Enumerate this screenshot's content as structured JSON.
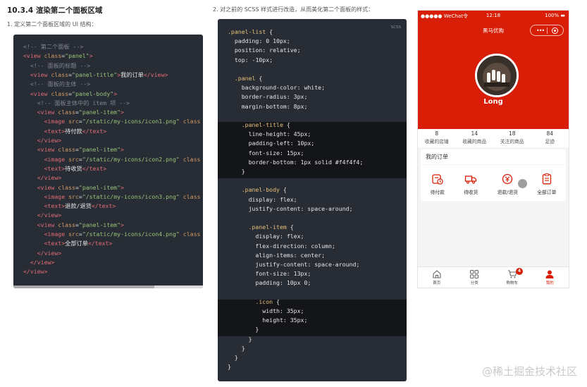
{
  "section_title": "10.3.4 渲染第二个面板区域",
  "step1": "1. 定义第二个面板区域的 UI 结构：",
  "step2": "2. 对之前的 SCSS 样式进行改造，从而美化第二个面板的样式：",
  "xml_code": [
    [
      {
        "c": "c-comment",
        "t": "<!-- 第二个面板 -->"
      }
    ],
    [
      {
        "c": "c-tag",
        "t": "<view "
      },
      {
        "c": "c-attr",
        "t": "class"
      },
      {
        "c": "c-txt",
        "t": "="
      },
      {
        "c": "c-str",
        "t": "\"panel\""
      },
      {
        "c": "c-tag",
        "t": ">"
      }
    ],
    [
      {
        "c": "c-txt",
        "t": "  "
      },
      {
        "c": "c-comment",
        "t": "<!-- 面板的标题 -->"
      }
    ],
    [
      {
        "c": "c-txt",
        "t": "  "
      },
      {
        "c": "c-tag",
        "t": "<view "
      },
      {
        "c": "c-attr",
        "t": "class"
      },
      {
        "c": "c-txt",
        "t": "="
      },
      {
        "c": "c-str",
        "t": "\"panel-title\""
      },
      {
        "c": "c-tag",
        "t": ">"
      },
      {
        "c": "c-txt",
        "t": "我的订单"
      },
      {
        "c": "c-tag",
        "t": "</view>"
      }
    ],
    [
      {
        "c": "c-txt",
        "t": "  "
      },
      {
        "c": "c-comment",
        "t": "<!-- 面板的主体 -->"
      }
    ],
    [
      {
        "c": "c-txt",
        "t": "  "
      },
      {
        "c": "c-tag",
        "t": "<view "
      },
      {
        "c": "c-attr",
        "t": "class"
      },
      {
        "c": "c-txt",
        "t": "="
      },
      {
        "c": "c-str",
        "t": "\"panel-body\""
      },
      {
        "c": "c-tag",
        "t": ">"
      }
    ],
    [
      {
        "c": "c-txt",
        "t": "    "
      },
      {
        "c": "c-comment",
        "t": "<!-- 面板主体中的 item 项 -->"
      }
    ],
    [
      {
        "c": "c-txt",
        "t": "    "
      },
      {
        "c": "c-tag",
        "t": "<view "
      },
      {
        "c": "c-attr",
        "t": "class"
      },
      {
        "c": "c-txt",
        "t": "="
      },
      {
        "c": "c-str",
        "t": "\"panel-item\""
      },
      {
        "c": "c-tag",
        "t": ">"
      }
    ],
    [
      {
        "c": "c-txt",
        "t": "      "
      },
      {
        "c": "c-tag",
        "t": "<image "
      },
      {
        "c": "c-attr",
        "t": "src"
      },
      {
        "c": "c-txt",
        "t": "="
      },
      {
        "c": "c-str",
        "t": "\"/static/my-icons/icon1.png\""
      },
      {
        "c": "c-attr",
        "t": " class"
      }
    ],
    [
      {
        "c": "c-txt",
        "t": "      "
      },
      {
        "c": "c-tag",
        "t": "<text>"
      },
      {
        "c": "c-txt",
        "t": "待付款"
      },
      {
        "c": "c-tag",
        "t": "</text>"
      }
    ],
    [
      {
        "c": "c-txt",
        "t": "    "
      },
      {
        "c": "c-tag",
        "t": "</view>"
      }
    ],
    [
      {
        "c": "c-txt",
        "t": "    "
      },
      {
        "c": "c-tag",
        "t": "<view "
      },
      {
        "c": "c-attr",
        "t": "class"
      },
      {
        "c": "c-txt",
        "t": "="
      },
      {
        "c": "c-str",
        "t": "\"panel-item\""
      },
      {
        "c": "c-tag",
        "t": ">"
      }
    ],
    [
      {
        "c": "c-txt",
        "t": "      "
      },
      {
        "c": "c-tag",
        "t": "<image "
      },
      {
        "c": "c-attr",
        "t": "src"
      },
      {
        "c": "c-txt",
        "t": "="
      },
      {
        "c": "c-str",
        "t": "\"/static/my-icons/icon2.png\""
      },
      {
        "c": "c-attr",
        "t": " class"
      }
    ],
    [
      {
        "c": "c-txt",
        "t": "      "
      },
      {
        "c": "c-tag",
        "t": "<text>"
      },
      {
        "c": "c-txt",
        "t": "待收货"
      },
      {
        "c": "c-tag",
        "t": "</text>"
      }
    ],
    [
      {
        "c": "c-txt",
        "t": "    "
      },
      {
        "c": "c-tag",
        "t": "</view>"
      }
    ],
    [
      {
        "c": "c-txt",
        "t": "    "
      },
      {
        "c": "c-tag",
        "t": "<view "
      },
      {
        "c": "c-attr",
        "t": "class"
      },
      {
        "c": "c-txt",
        "t": "="
      },
      {
        "c": "c-str",
        "t": "\"panel-item\""
      },
      {
        "c": "c-tag",
        "t": ">"
      }
    ],
    [
      {
        "c": "c-txt",
        "t": "      "
      },
      {
        "c": "c-tag",
        "t": "<image "
      },
      {
        "c": "c-attr",
        "t": "src"
      },
      {
        "c": "c-txt",
        "t": "="
      },
      {
        "c": "c-str",
        "t": "\"/static/my-icons/icon3.png\""
      },
      {
        "c": "c-attr",
        "t": " class"
      }
    ],
    [
      {
        "c": "c-txt",
        "t": "      "
      },
      {
        "c": "c-tag",
        "t": "<text>"
      },
      {
        "c": "c-txt",
        "t": "退款/退货"
      },
      {
        "c": "c-tag",
        "t": "</text>"
      }
    ],
    [
      {
        "c": "c-txt",
        "t": "    "
      },
      {
        "c": "c-tag",
        "t": "</view>"
      }
    ],
    [
      {
        "c": "c-txt",
        "t": "    "
      },
      {
        "c": "c-tag",
        "t": "<view "
      },
      {
        "c": "c-attr",
        "t": "class"
      },
      {
        "c": "c-txt",
        "t": "="
      },
      {
        "c": "c-str",
        "t": "\"panel-item\""
      },
      {
        "c": "c-tag",
        "t": ">"
      }
    ],
    [
      {
        "c": "c-txt",
        "t": "      "
      },
      {
        "c": "c-tag",
        "t": "<image "
      },
      {
        "c": "c-attr",
        "t": "src"
      },
      {
        "c": "c-txt",
        "t": "="
      },
      {
        "c": "c-str",
        "t": "\"/static/my-icons/icon4.png\""
      },
      {
        "c": "c-attr",
        "t": " class"
      }
    ],
    [
      {
        "c": "c-txt",
        "t": "      "
      },
      {
        "c": "c-tag",
        "t": "<text>"
      },
      {
        "c": "c-txt",
        "t": "全部订单"
      },
      {
        "c": "c-tag",
        "t": "</text>"
      }
    ],
    [
      {
        "c": "c-txt",
        "t": "    "
      },
      {
        "c": "c-tag",
        "t": "</view>"
      }
    ],
    [
      {
        "c": "c-txt",
        "t": "  "
      },
      {
        "c": "c-tag",
        "t": "</view>"
      }
    ],
    [
      {
        "c": "c-tag",
        "t": "</view>"
      }
    ]
  ],
  "scss_lang": "SCSS",
  "scss_code": [
    [
      {
        "c": "c-sel",
        "t": ".panel-list "
      },
      {
        "c": "c-brace",
        "t": "{"
      }
    ],
    [
      {
        "c": "c-prop",
        "t": "  padding: "
      },
      {
        "c": "c-val",
        "t": "0 10px;"
      }
    ],
    [
      {
        "c": "c-prop",
        "t": "  position: "
      },
      {
        "c": "c-val",
        "t": "relative;"
      }
    ],
    [
      {
        "c": "c-prop",
        "t": "  top: "
      },
      {
        "c": "c-val",
        "t": "-10px;"
      }
    ],
    [
      {
        "c": "c-txt",
        "t": ""
      }
    ],
    [
      {
        "c": "c-sel",
        "t": "  .panel "
      },
      {
        "c": "c-brace",
        "t": "{"
      }
    ],
    [
      {
        "c": "c-prop",
        "t": "    background-color: "
      },
      {
        "c": "c-val",
        "t": "white;"
      }
    ],
    [
      {
        "c": "c-prop",
        "t": "    border-radius: "
      },
      {
        "c": "c-val",
        "t": "3px;"
      }
    ],
    [
      {
        "c": "c-prop",
        "t": "    margin-bottom: "
      },
      {
        "c": "c-val",
        "t": "8px;"
      }
    ],
    [
      {
        "c": "c-txt",
        "t": ""
      }
    ],
    [
      {
        "c": "c-sel",
        "t": "    .panel-title "
      },
      {
        "c": "c-brace",
        "t": "{"
      }
    ],
    [
      {
        "c": "c-prop",
        "t": "      line-height: "
      },
      {
        "c": "c-val",
        "t": "45px;"
      }
    ],
    [
      {
        "c": "c-prop",
        "t": "      padding-left: "
      },
      {
        "c": "c-val",
        "t": "10px;"
      }
    ],
    [
      {
        "c": "c-prop",
        "t": "      font-size: "
      },
      {
        "c": "c-val",
        "t": "15px;"
      }
    ],
    [
      {
        "c": "c-prop",
        "t": "      border-bottom: "
      },
      {
        "c": "c-val",
        "t": "1px solid #f4f4f4;"
      }
    ],
    [
      {
        "c": "c-brace",
        "t": "    }"
      }
    ],
    [
      {
        "c": "c-txt",
        "t": ""
      }
    ],
    [
      {
        "c": "c-sel",
        "t": "    .panel-body "
      },
      {
        "c": "c-brace",
        "t": "{"
      }
    ],
    [
      {
        "c": "c-prop",
        "t": "      display: "
      },
      {
        "c": "c-val",
        "t": "flex;"
      }
    ],
    [
      {
        "c": "c-prop",
        "t": "      justify-content: "
      },
      {
        "c": "c-val",
        "t": "space-around;"
      }
    ],
    [
      {
        "c": "c-txt",
        "t": ""
      }
    ],
    [
      {
        "c": "c-sel",
        "t": "      .panel-item "
      },
      {
        "c": "c-brace",
        "t": "{"
      }
    ],
    [
      {
        "c": "c-prop",
        "t": "        display: "
      },
      {
        "c": "c-val",
        "t": "flex;"
      }
    ],
    [
      {
        "c": "c-prop",
        "t": "        flex-direction: "
      },
      {
        "c": "c-val",
        "t": "column;"
      }
    ],
    [
      {
        "c": "c-prop",
        "t": "        align-items: "
      },
      {
        "c": "c-val",
        "t": "center;"
      }
    ],
    [
      {
        "c": "c-prop",
        "t": "        justify-content: "
      },
      {
        "c": "c-val",
        "t": "space-around;"
      }
    ],
    [
      {
        "c": "c-prop",
        "t": "        font-size: "
      },
      {
        "c": "c-val",
        "t": "13px;"
      }
    ],
    [
      {
        "c": "c-prop",
        "t": "        padding: "
      },
      {
        "c": "c-val",
        "t": "10px 0;"
      }
    ],
    [
      {
        "c": "c-txt",
        "t": ""
      }
    ],
    [
      {
        "c": "c-sel",
        "t": "        .icon "
      },
      {
        "c": "c-brace",
        "t": "{"
      }
    ],
    [
      {
        "c": "c-prop",
        "t": "          width: "
      },
      {
        "c": "c-val",
        "t": "35px;"
      }
    ],
    [
      {
        "c": "c-prop",
        "t": "          height: "
      },
      {
        "c": "c-val",
        "t": "35px;"
      }
    ],
    [
      {
        "c": "c-brace",
        "t": "        }"
      }
    ],
    [
      {
        "c": "c-brace",
        "t": "      }"
      }
    ],
    [
      {
        "c": "c-brace",
        "t": "    }"
      }
    ],
    [
      {
        "c": "c-brace",
        "t": "  }"
      }
    ],
    [
      {
        "c": "c-brace",
        "t": "}"
      }
    ]
  ],
  "phone": {
    "status_left": "●●●●● WeChat令",
    "status_time": "12:18",
    "status_right": "100% ▬",
    "nav_title": "黑马优购",
    "capsule_dots": "•••",
    "username": "Long",
    "stats": [
      {
        "num": "8",
        "label": "收藏的店铺"
      },
      {
        "num": "14",
        "label": "收藏的商品"
      },
      {
        "num": "18",
        "label": "关注的商品"
      },
      {
        "num": "84",
        "label": "足迹"
      }
    ],
    "panel_title": "我的订单",
    "panel_items": [
      {
        "label": "待付款",
        "icon": "wallet-clock-icon"
      },
      {
        "label": "待收货",
        "icon": "truck-icon"
      },
      {
        "label": "退款/退货",
        "icon": "yen-return-icon"
      },
      {
        "label": "全部订单",
        "icon": "clipboard-list-icon"
      }
    ],
    "tabs": [
      {
        "label": "首页",
        "icon": "home-icon"
      },
      {
        "label": "分类",
        "icon": "grid-icon"
      },
      {
        "label": "购物车",
        "icon": "cart-icon",
        "badge": "4"
      },
      {
        "label": "我的",
        "icon": "user-icon",
        "active": true
      }
    ],
    "accent": "#d81e06"
  },
  "watermark": "@稀土掘金技术社区"
}
